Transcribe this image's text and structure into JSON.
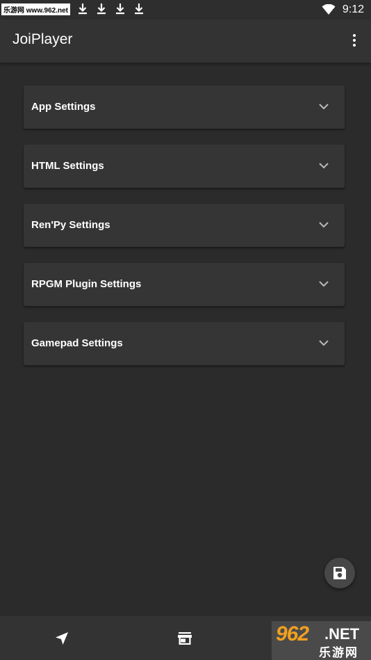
{
  "status_bar": {
    "watermark": "乐游网 www.962.net",
    "time": "9:12"
  },
  "app_bar": {
    "title": "JoiPlayer",
    "menu_icon": "more-vert-icon"
  },
  "panels": [
    {
      "label": "App Settings"
    },
    {
      "label": "HTML Settings"
    },
    {
      "label": "Ren'Py Settings"
    },
    {
      "label": "RPGM Plugin Settings"
    },
    {
      "label": "Gamepad Settings"
    }
  ],
  "fab": {
    "icon": "save-icon"
  },
  "bottom_nav": {
    "items": [
      {
        "icon": "navigation-arrow-icon"
      },
      {
        "icon": "store-icon"
      }
    ]
  },
  "watermark_bottom": {
    "brand_number": "962",
    "brand_suffix": ".NET",
    "brand_cn": "乐游网"
  },
  "colors": {
    "background": "#2b2b2b",
    "app_bar": "#333333",
    "panel": "#353535",
    "text": "#ffffff",
    "icon_muted": "#bbbbbb"
  }
}
